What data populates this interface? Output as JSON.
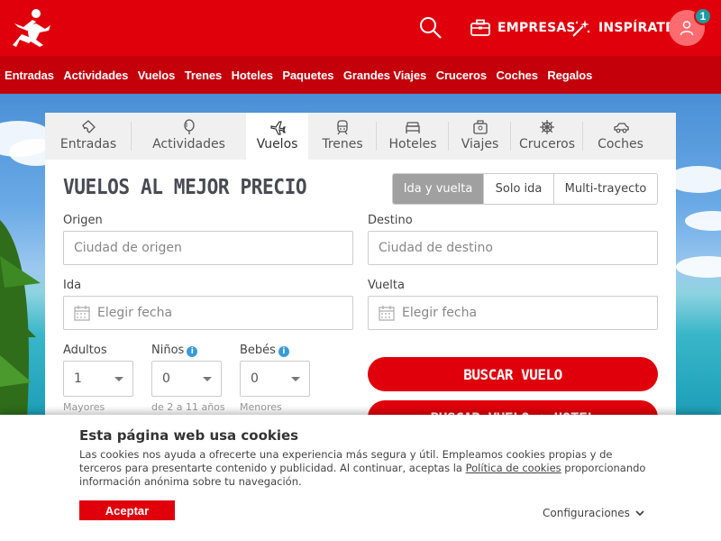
{
  "header": {
    "empresas_label": "EMPRESAS",
    "inspirate_label": "INSPÍRATE",
    "notification_count": "1"
  },
  "nav": {
    "items": [
      "Entradas",
      "Actividades",
      "Vuelos",
      "Trenes",
      "Hoteles",
      "Paquetes",
      "Grandes Viajes",
      "Cruceros",
      "Coches",
      "Regalos"
    ]
  },
  "tabs": [
    {
      "label": "Entradas",
      "icon": "ticket-icon"
    },
    {
      "label": "Actividades",
      "icon": "balloon-icon"
    },
    {
      "label": "Vuelos",
      "icon": "plane-icon",
      "active": true
    },
    {
      "label": "Trenes",
      "icon": "train-icon"
    },
    {
      "label": "Hoteles",
      "icon": "bed-icon"
    },
    {
      "label": "Viajes",
      "icon": "suitcase-icon"
    },
    {
      "label": "Cruceros",
      "icon": "helm-icon"
    },
    {
      "label": "Coches",
      "icon": "car-icon"
    }
  ],
  "search": {
    "title": "VUELOS AL MEJOR PRECIO",
    "trip_types": [
      "Ida y vuelta",
      "Solo ida",
      "Multi-trayecto"
    ],
    "selected_trip_type": "Ida y vuelta",
    "origin_label": "Origen",
    "origin_placeholder": "Ciudad de origen",
    "destination_label": "Destino",
    "destination_placeholder": "Ciudad de destino",
    "departure_label": "Ida",
    "departure_placeholder": "Elegir fecha",
    "return_label": "Vuelta",
    "return_placeholder": "Elegir fecha",
    "adults_label": "Adultos",
    "adults_value": "1",
    "adults_hint": "Mayores",
    "children_label": "Niños",
    "children_value": "0",
    "children_hint": "de 2 a 11 años",
    "infants_label": "Bebés",
    "infants_value": "0",
    "infants_hint": "Menores",
    "search_button": "BUSCAR VUELO",
    "search_hotel_button": "BUSCAR VUELO + HOTEL"
  },
  "cookie": {
    "title": "Esta página web usa cookies",
    "text_before_link": "Las cookies nos ayuda a ofrecerte una experiencia más segura y útil. Empleamos cookies propias y de terceros para presentarte contenido y publicidad. Al continuar, aceptas la ",
    "link_text": "Política de cookies",
    "text_after_link": " proporcionando información anónima sobre tu navegación.",
    "accept_label": "Aceptar",
    "config_label": "Configuraciones"
  },
  "colors": {
    "brand_red": "#e0000b",
    "nav_red": "#c4000a",
    "badge_teal": "#1a9ca0"
  }
}
